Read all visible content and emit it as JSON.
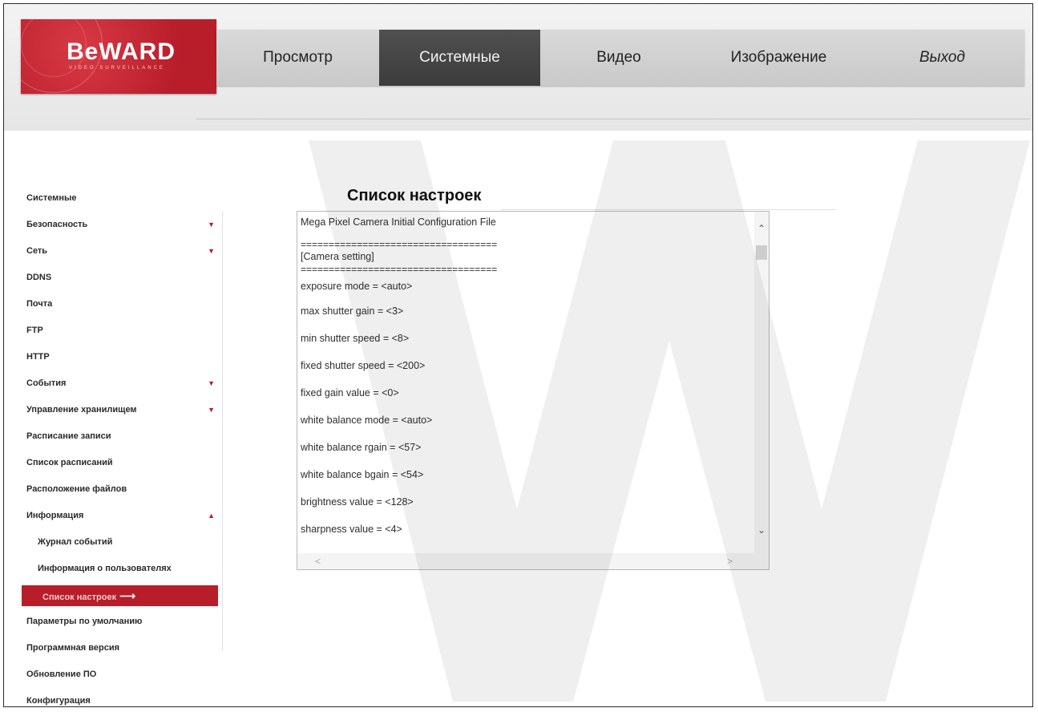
{
  "logo": {
    "text": "BeWARD",
    "subtitle": "VIDEO SURVEILLANCE"
  },
  "nav": [
    {
      "label": "Просмотр",
      "active": false
    },
    {
      "label": "Системные",
      "active": true
    },
    {
      "label": "Видео",
      "active": false
    },
    {
      "label": "Изображение",
      "active": false
    },
    {
      "label": "Выход",
      "active": false
    }
  ],
  "sidebar": {
    "items": [
      {
        "label": "Системные"
      },
      {
        "label": "Безопасность",
        "arrow": "▼"
      },
      {
        "label": "Сеть",
        "arrow": "▼"
      },
      {
        "label": "DDNS"
      },
      {
        "label": "Почта"
      },
      {
        "label": "FTP"
      },
      {
        "label": "HTTP"
      },
      {
        "label": "События",
        "arrow": "▼"
      },
      {
        "label": "Управление хранилищем",
        "arrow": "▼"
      },
      {
        "label": "Расписание записи"
      },
      {
        "label": "Список расписаний"
      },
      {
        "label": "Расположение файлов"
      },
      {
        "label": "Информация",
        "arrow": "▲"
      },
      {
        "label": "Журнал событий"
      },
      {
        "label": "Информация о пользователях"
      },
      {
        "label": "Список настроек",
        "active_arrow": "⟶"
      },
      {
        "label": "Параметры по умолчанию"
      },
      {
        "label": "Программная версия"
      },
      {
        "label": "Обновление ПО"
      },
      {
        "label": "Конфигурация"
      }
    ]
  },
  "main": {
    "title": "Список настроек",
    "config": {
      "file_title": "Mega Pixel Camera Initial Configuration File",
      "separator": "===================================",
      "section": "[Camera setting]",
      "lines": [
        "exposure mode = <auto>",
        "max shutter gain = <3>",
        "min shutter speed = <8>",
        "fixed shutter speed = <200>",
        "fixed gain value = <0>",
        "white balance mode = <auto>",
        "white balance rgain = <57>",
        "white balance bgain = <54>",
        "brightness value = <128>",
        "sharpness value = <4>"
      ]
    },
    "scrollbar": {
      "up": "⌃",
      "down": "⌄",
      "left": "<",
      "right": ">"
    }
  }
}
